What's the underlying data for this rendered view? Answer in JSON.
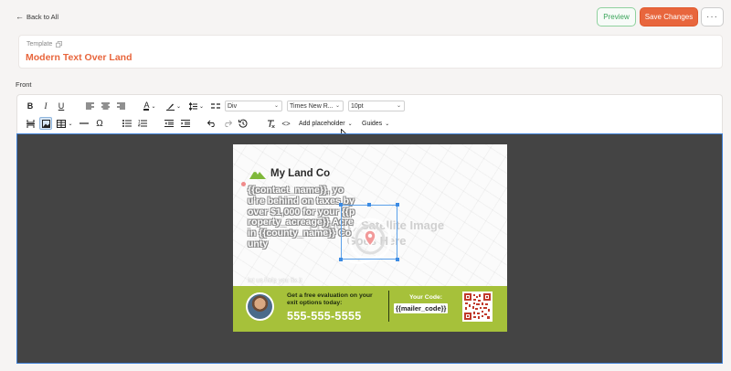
{
  "header": {
    "back_label": "Back to All",
    "preview_label": "Preview",
    "save_label": "Save Changes",
    "more_label": "···"
  },
  "template": {
    "label": "Template",
    "name": "Modern Text Over Land"
  },
  "section": {
    "front_label": "Front"
  },
  "toolbar": {
    "bold": "B",
    "italic": "I",
    "underline": "U",
    "omega": "Ω",
    "font_text_icon": "A",
    "block_format": "Div",
    "font_family": "Times New R...",
    "font_size": "10pt",
    "add_placeholder": "Add placeholder",
    "guides": "Guides",
    "code": "<>"
  },
  "postcard": {
    "logo_text": "My Land Co",
    "body_text": "{{contact_name}}, you're behind on taxes by over $1,000 for your {{property_acreage}} Acre in {{county_name}} County",
    "sub_text": "let us help you fix it",
    "placeholder_text": "Property Satellite Image Goes Here",
    "cta_text": "Get a free evaluation on your exit options today:",
    "phone": "555-555-5555",
    "code_label": "Your Code:",
    "code_value": "{{mailer_code}}"
  },
  "colors": {
    "accent": "#e8663d",
    "preview_green": "#3aa55a",
    "canvas_bg": "#444444",
    "postcard_bar": "#a6c13a",
    "selection_blue": "#3c8be3"
  }
}
